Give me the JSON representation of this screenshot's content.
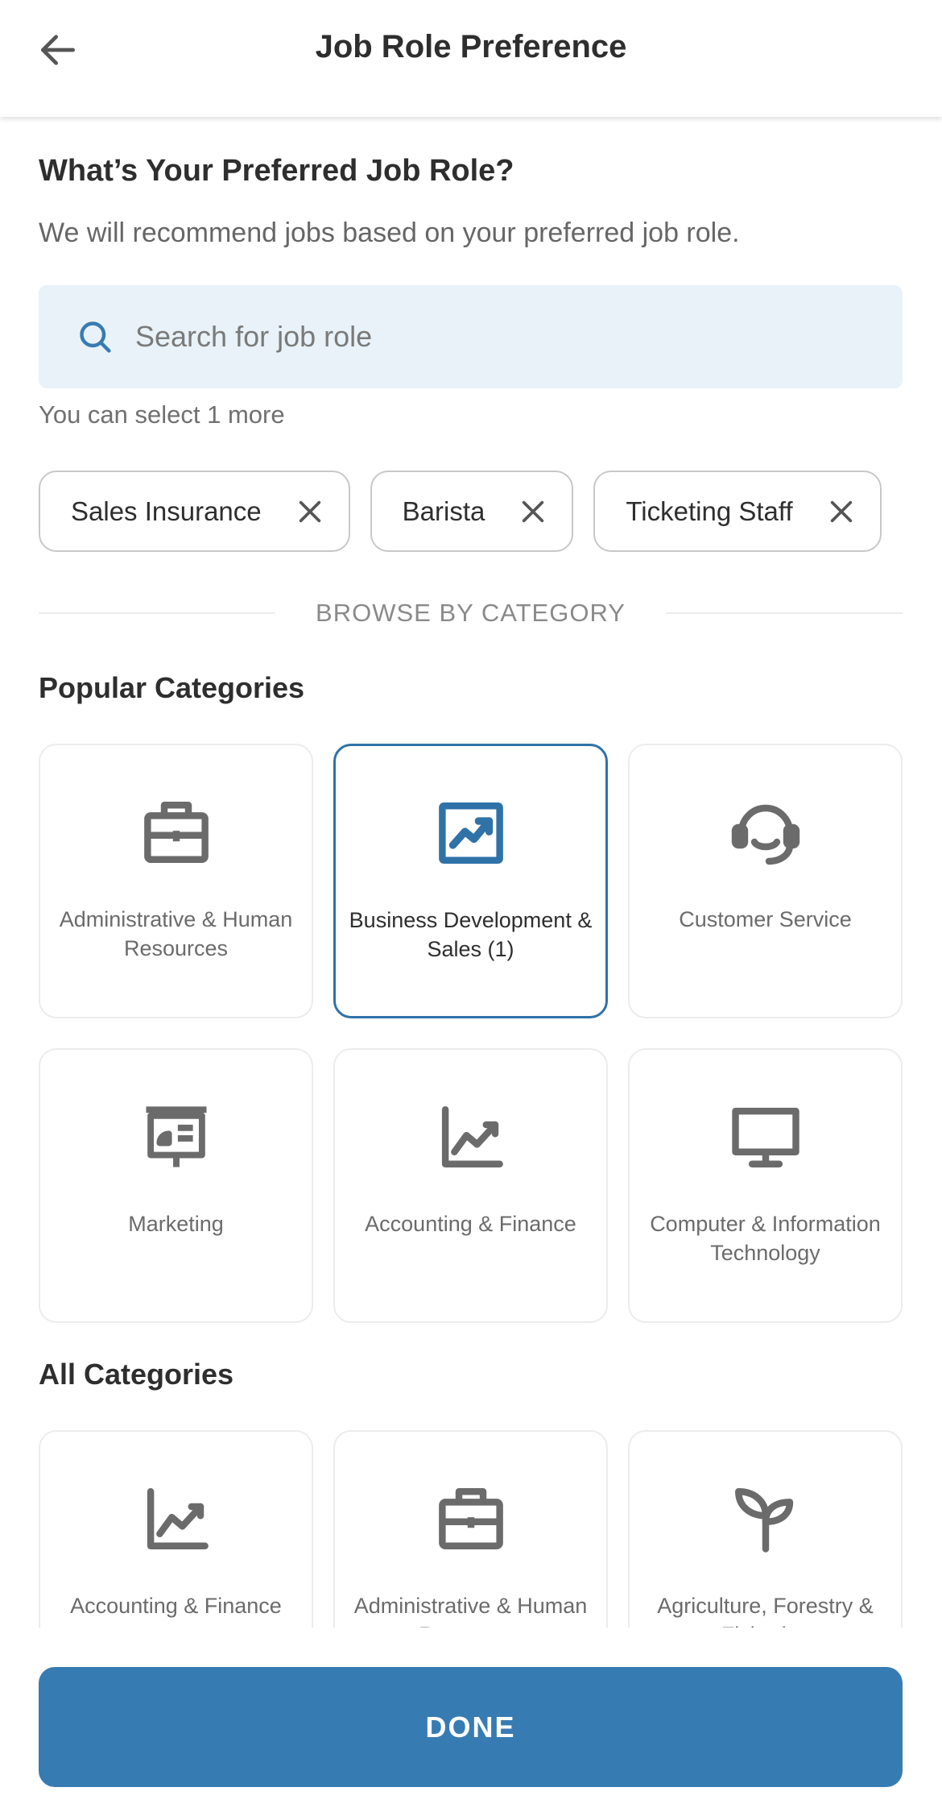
{
  "header": {
    "title": "Job Role Preference"
  },
  "intro": {
    "title": "What’s Your Preferred Job Role?",
    "subtitle": "We will recommend jobs based on your preferred job role."
  },
  "search": {
    "placeholder": "Search for job role",
    "value": ""
  },
  "hint": "You can select 1 more",
  "selected_roles": [
    {
      "label": "Sales Insurance"
    },
    {
      "label": "Barista"
    },
    {
      "label": "Ticketing Staff"
    }
  ],
  "browse_label": "BROWSE BY CATEGORY",
  "popular": {
    "title": "Popular Categories",
    "items": [
      {
        "label": "Administrative & Human Resources",
        "icon": "briefcase-icon"
      },
      {
        "label": "Business Development & Sales (1)",
        "icon": "chart-up-icon"
      },
      {
        "label": "Customer Service",
        "icon": "headset-icon"
      },
      {
        "label": "Marketing",
        "icon": "presentation-icon"
      },
      {
        "label": "Accounting & Finance",
        "icon": "line-chart-icon"
      },
      {
        "label": "Computer & Information Technology",
        "icon": "monitor-icon"
      }
    ]
  },
  "all": {
    "title": "All Categories",
    "items": [
      {
        "label": "Accounting & Finance",
        "icon": "line-chart-icon"
      },
      {
        "label": "Administrative & Human Resources",
        "icon": "briefcase-icon"
      },
      {
        "label": "Agriculture, Forestry & Fisheries",
        "icon": "sprout-icon"
      }
    ]
  },
  "footer": {
    "done_label": "DONE"
  },
  "colors": {
    "accent": "#377bb3",
    "selected_border": "#2f72a8",
    "search_bg": "#e8f2f8",
    "icon_gray": "#6b6b6b"
  }
}
